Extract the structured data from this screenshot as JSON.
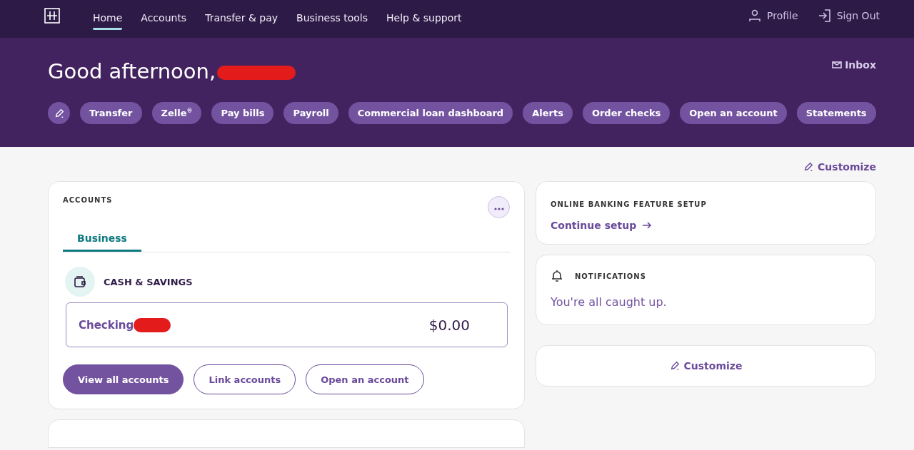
{
  "nav": {
    "items": [
      {
        "label": "Home",
        "selected": true
      },
      {
        "label": "Accounts",
        "selected": false
      },
      {
        "label": "Transfer & pay",
        "selected": false
      },
      {
        "label": "Business tools",
        "selected": false
      },
      {
        "label": "Help & support",
        "selected": false
      }
    ],
    "profile": "Profile",
    "sign_out": "Sign Out"
  },
  "header": {
    "greeting": "Good afternoon,",
    "inbox": "Inbox",
    "quick_links": [
      "Transfer",
      "Zelle$^{®}$",
      "Pay bills",
      "Payroll",
      "Commercial loan dashboard",
      "Alerts",
      "Order checks",
      "Open an account",
      "Statements"
    ]
  },
  "customize_top": "Customize",
  "accounts": {
    "title": "ACCOUNTS",
    "tabs": [
      {
        "label": "Business",
        "selected": true
      }
    ],
    "group": "CASH & SAVINGS",
    "rows": [
      {
        "name": "Checking",
        "balance": "$0.00"
      }
    ],
    "buttons": [
      {
        "label": "View all accounts",
        "kind": "primary"
      },
      {
        "label": "Link accounts",
        "kind": "outline"
      },
      {
        "label": "Open an account",
        "kind": "outline"
      }
    ]
  },
  "setup": {
    "title": "ONLINE BANKING FEATURE SETUP",
    "link": "Continue setup"
  },
  "notifications": {
    "title": "NOTIFICATIONS",
    "message": "You're all caught up."
  },
  "customize_card": "Customize"
}
